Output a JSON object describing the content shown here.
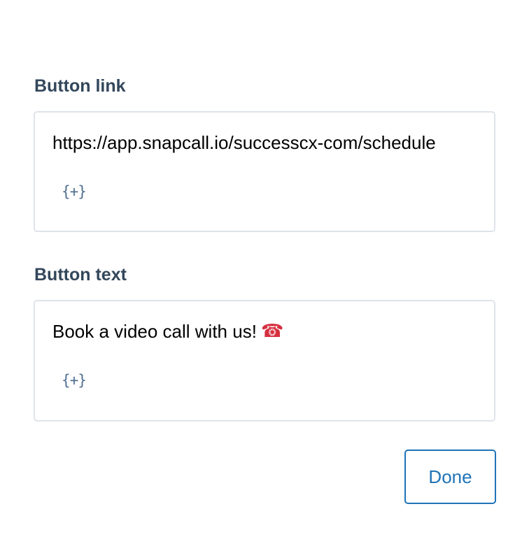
{
  "button_link": {
    "label": "Button link",
    "value": "https://app.snapcall.io/successcx-com/schedule",
    "token_button": "{+}"
  },
  "button_text": {
    "label": "Button text",
    "value": "Book a video call with us!",
    "emoji_icon": "telephone-icon",
    "emoji_color": "#d62f3f",
    "token_button": "{+}"
  },
  "footer": {
    "done_label": "Done"
  },
  "colors": {
    "label": "#33475b",
    "border": "#dfe3eb",
    "token": "#516f90",
    "accent": "#1f73b7"
  }
}
